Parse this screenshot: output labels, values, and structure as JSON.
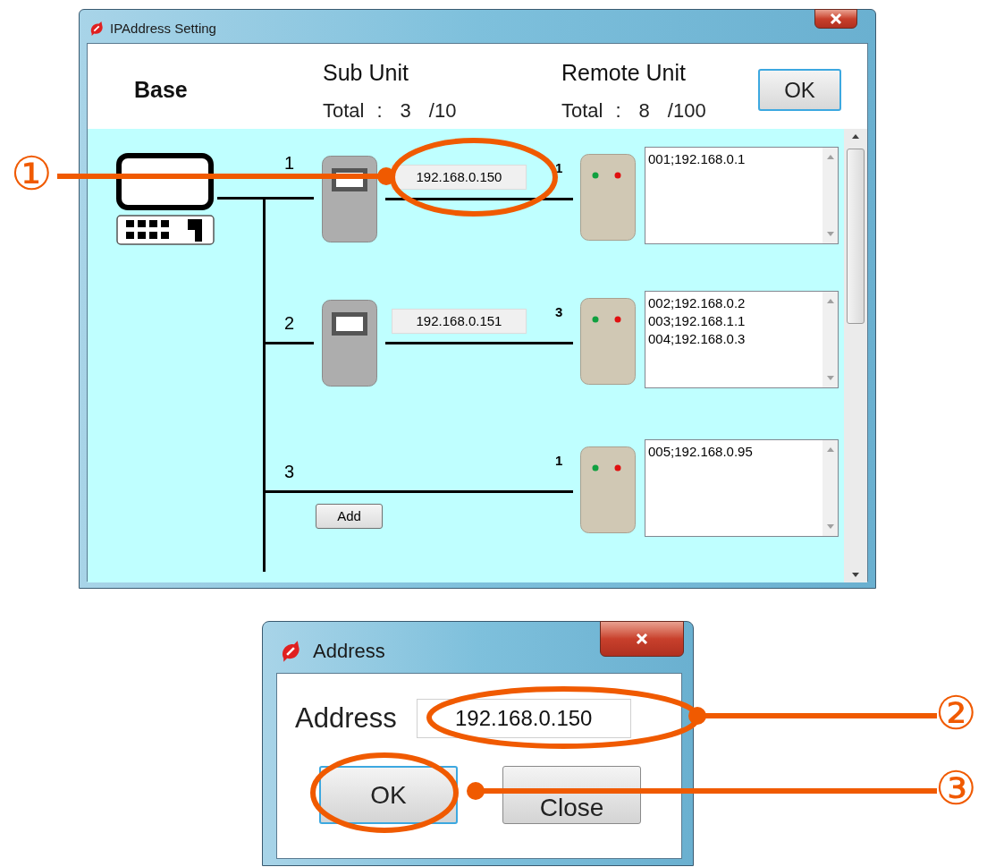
{
  "main_window": {
    "title": "IPAddress Setting",
    "header": {
      "base_label": "Base",
      "sub_unit": {
        "title": "Sub Unit",
        "total_label": "Total",
        "separator": ":",
        "count": "3",
        "max": "/10"
      },
      "remote_unit": {
        "title": "Remote Unit",
        "total_label": "Total",
        "separator": ":",
        "count": "8",
        "max": "/100"
      },
      "ok_button": "OK"
    },
    "rows": [
      {
        "kind": "device",
        "number": "1",
        "ip": "192.168.0.150",
        "remote_count": "1",
        "remotes": [
          "001;192.168.0.1"
        ]
      },
      {
        "kind": "device",
        "number": "2",
        "ip": "192.168.0.151",
        "remote_count": "3",
        "remotes": [
          "002;192.168.0.2",
          "003;192.168.1.1",
          "004;192.168.0.3"
        ]
      },
      {
        "kind": "add",
        "number": "3",
        "add_button": "Add",
        "remote_count": "1",
        "remotes": [
          "005;192.168.0.95"
        ]
      }
    ]
  },
  "address_dialog": {
    "title": "Address",
    "label": "Address",
    "value": "192.168.0.150",
    "buttons": [
      {
        "label": "OK",
        "default": true
      },
      {
        "label": "Close",
        "default": false
      }
    ]
  },
  "callouts": [
    {
      "mark": "①"
    },
    {
      "mark": "②"
    },
    {
      "mark": "③"
    }
  ]
}
